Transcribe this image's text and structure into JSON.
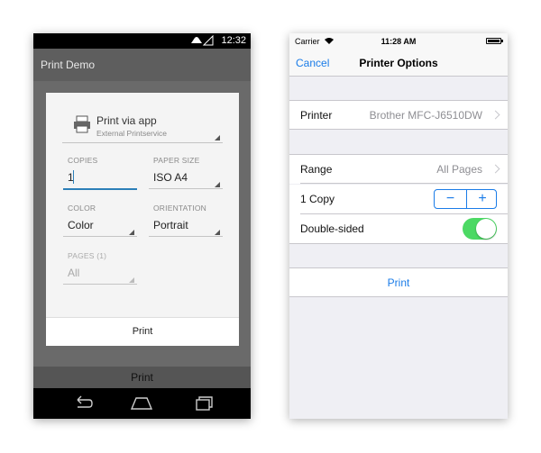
{
  "android": {
    "status_time": "12:32",
    "app_title": "Print Demo",
    "dialog": {
      "service_name": "Print via app",
      "service_sub": "External Printservice",
      "copies_label": "COPIES",
      "copies_value": "1",
      "paper_size_label": "PAPER SIZE",
      "paper_size_value": "ISO A4",
      "color_label": "COLOR",
      "color_value": "Color",
      "orientation_label": "ORIENTATION",
      "orientation_value": "Portrait",
      "pages_label": "PAGES (1)",
      "pages_value": "All",
      "print_label": "Print"
    },
    "background_print_label": "Print",
    "nav_icons": [
      "back-icon",
      "home-icon",
      "recents-icon"
    ]
  },
  "ios": {
    "carrier": "Carrier",
    "time": "11:28 AM",
    "cancel_label": "Cancel",
    "title": "Printer Options",
    "printer_label": "Printer",
    "printer_value": "Brother MFC-J6510DW",
    "range_label": "Range",
    "range_value": "All Pages",
    "copies_label": "1 Copy",
    "stepper_minus": "−",
    "stepper_plus": "+",
    "double_sided_label": "Double-sided",
    "double_sided_on": true,
    "print_label": "Print",
    "accent_color": "#1a7ce8",
    "switch_color": "#4cd964"
  }
}
